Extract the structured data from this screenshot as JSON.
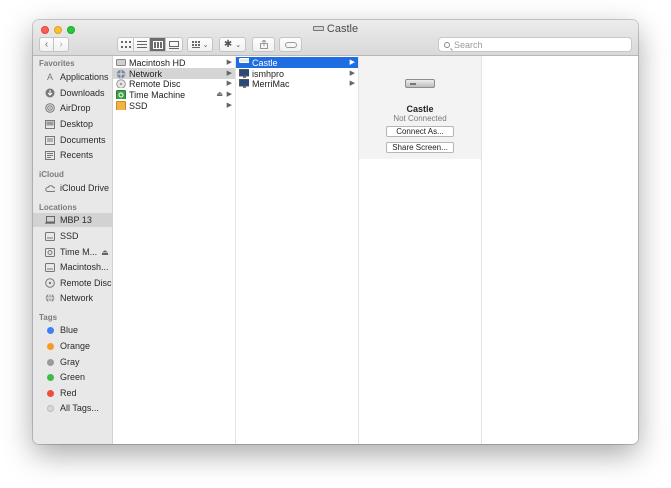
{
  "window": {
    "title": "Castle"
  },
  "toolbar": {
    "search_placeholder": "Search"
  },
  "sidebar": {
    "favorites_title": "Favorites",
    "favorites": [
      {
        "label": "Applications",
        "icon": "applications-icon"
      },
      {
        "label": "Downloads",
        "icon": "downloads-icon"
      },
      {
        "label": "AirDrop",
        "icon": "airdrop-icon"
      },
      {
        "label": "Desktop",
        "icon": "desktop-icon"
      },
      {
        "label": "Documents",
        "icon": "documents-icon"
      },
      {
        "label": "Recents",
        "icon": "recents-icon"
      }
    ],
    "icloud_title": "iCloud",
    "icloud": [
      {
        "label": "iCloud Drive",
        "icon": "cloud-icon"
      }
    ],
    "locations_title": "Locations",
    "locations": [
      {
        "label": "MBP 13",
        "icon": "laptop-icon",
        "selected": true
      },
      {
        "label": "SSD",
        "icon": "disk-icon"
      },
      {
        "label": "Time M...",
        "icon": "time-machine-icon",
        "eject": true
      },
      {
        "label": "Macintosh...",
        "icon": "disk-icon"
      },
      {
        "label": "Remote Disc",
        "icon": "remote-disc-icon"
      },
      {
        "label": "Network",
        "icon": "globe-icon"
      }
    ],
    "tags_title": "Tags",
    "tags": [
      {
        "label": "Blue",
        "color": "#3b82f6"
      },
      {
        "label": "Orange",
        "color": "#f59a23"
      },
      {
        "label": "Gray",
        "color": "#9a9a9a"
      },
      {
        "label": "Green",
        "color": "#3dbb4a"
      },
      {
        "label": "Red",
        "color": "#f04b41"
      },
      {
        "label": "All Tags...",
        "color": "#d8d8d8"
      }
    ]
  },
  "columns": {
    "col1": [
      {
        "label": "Macintosh HD",
        "arrow": true
      },
      {
        "label": "Network",
        "arrow": true,
        "selected": true
      },
      {
        "label": "Remote Disc",
        "arrow": true
      },
      {
        "label": "Time Machine",
        "arrow": true,
        "eject": true
      },
      {
        "label": "SSD",
        "arrow": true
      }
    ],
    "col2": [
      {
        "label": "Castle",
        "arrow": true,
        "selected": true
      },
      {
        "label": "ismhpro",
        "arrow": true
      },
      {
        "label": "MerriMac",
        "arrow": true
      }
    ]
  },
  "preview": {
    "name": "Castle",
    "status": "Not Connected",
    "connect_button": "Connect As...",
    "share_button": "Share Screen..."
  }
}
